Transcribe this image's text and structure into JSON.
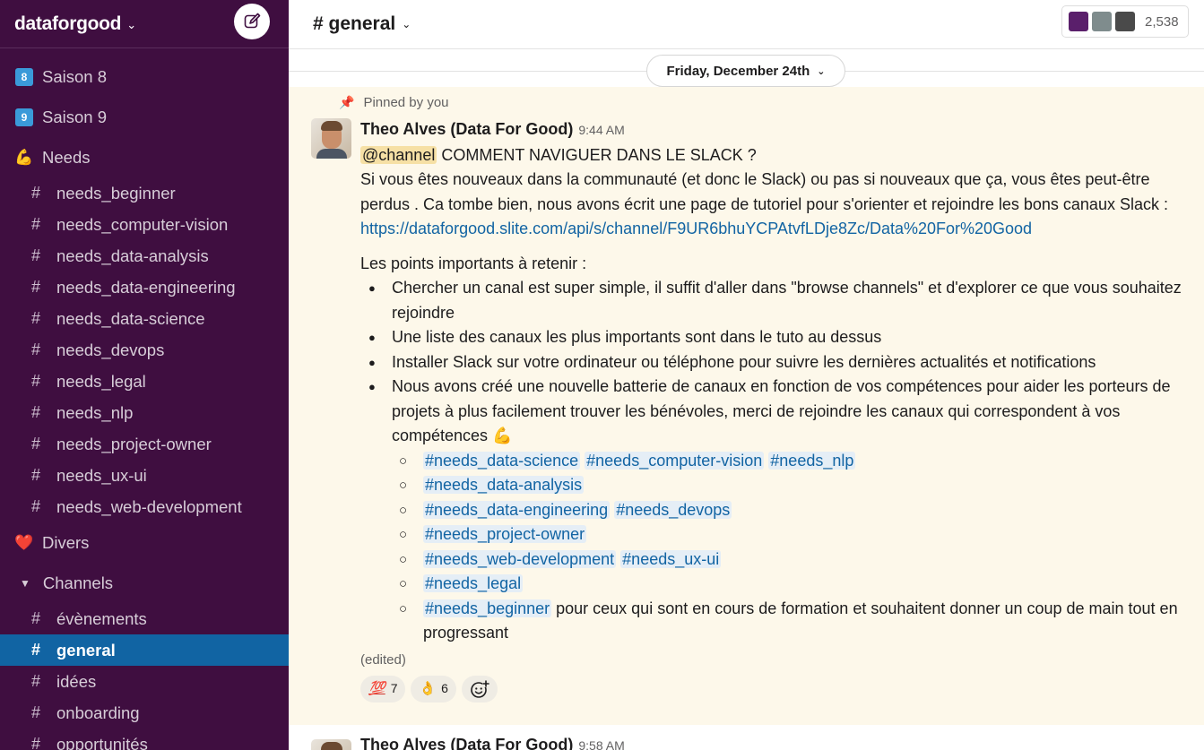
{
  "workspace": {
    "name": "dataforgood"
  },
  "sidebar": {
    "sections": [
      {
        "id": "saison8",
        "emoji": "8",
        "label": "Saison 8"
      },
      {
        "id": "saison9",
        "emoji": "9",
        "label": "Saison 9"
      },
      {
        "id": "needs",
        "emoji": "💪",
        "label": "Needs"
      }
    ],
    "needs_channels": [
      "needs_beginner",
      "needs_computer-vision",
      "needs_data-analysis",
      "needs_data-engineering",
      "needs_data-science",
      "needs_devops",
      "needs_legal",
      "needs_nlp",
      "needs_project-owner",
      "needs_ux-ui",
      "needs_web-development"
    ],
    "divers": {
      "emoji": "❤️",
      "label": "Divers"
    },
    "channels_header": "Channels",
    "channels": [
      "évènements",
      "general",
      "idées",
      "onboarding",
      "opportunités"
    ],
    "active_channel": "general"
  },
  "header": {
    "title": "# general",
    "member_count": "2,538"
  },
  "date_divider": "Friday, December 24th",
  "pinned": {
    "label": "Pinned by you",
    "author": "Theo Alves (Data For Good)",
    "time": "9:44 AM",
    "mention": "@channel",
    "title_text": " COMMENT NAVIGUER DANS LE SLACK ?",
    "intro": "Si vous êtes nouveaux dans la communauté (et donc le Slack) ou pas si nouveaux que ça, vous êtes peut-être perdus . Ca tombe bien, nous avons écrit une page de tutoriel pour s'orienter et rejoindre les bons canaux Slack :",
    "link": "https://dataforgood.slite.com/api/s/channel/F9UR6bhuYCPAtvfLDje8Zc/Data%20For%20Good",
    "points_intro": "Les points importants à retenir :",
    "bullets": [
      "Chercher un canal est super simple, il suffit d'aller dans \"browse channels\" et d'explorer ce que vous souhaitez rejoindre",
      "Une liste des canaux les plus importants sont dans le tuto au dessus",
      "Installer Slack sur votre ordinateur ou téléphone pour suivre les dernières actualités et notifications",
      "Nous avons créé une nouvelle batterie de canaux en fonction de vos compétences pour aider les porteurs de projets à plus facilement trouver les bénévoles, merci de rejoindre les canaux qui correspondent à vos compétences"
    ],
    "bullet4_emoji": "💪",
    "sub_items": [
      [
        "#needs_data-science",
        "#needs_computer-vision",
        "#needs_nlp"
      ],
      [
        "#needs_data-analysis"
      ],
      [
        "#needs_data-engineering",
        "#needs_devops"
      ],
      [
        "#needs_project-owner"
      ],
      [
        "#needs_web-development",
        "#needs_ux-ui"
      ],
      [
        "#needs_legal"
      ],
      [
        "#needs_beginner"
      ]
    ],
    "beginner_suffix": " pour ceux qui sont en cours de formation et souhaitent donner un coup de main tout en progressant",
    "edited": "(edited)",
    "reactions": [
      {
        "emoji": "💯",
        "count": "7"
      },
      {
        "emoji": "👌",
        "count": "6"
      }
    ]
  },
  "next_message": {
    "author": "Theo Alves (Data For Good)",
    "time": "9:58 AM"
  }
}
